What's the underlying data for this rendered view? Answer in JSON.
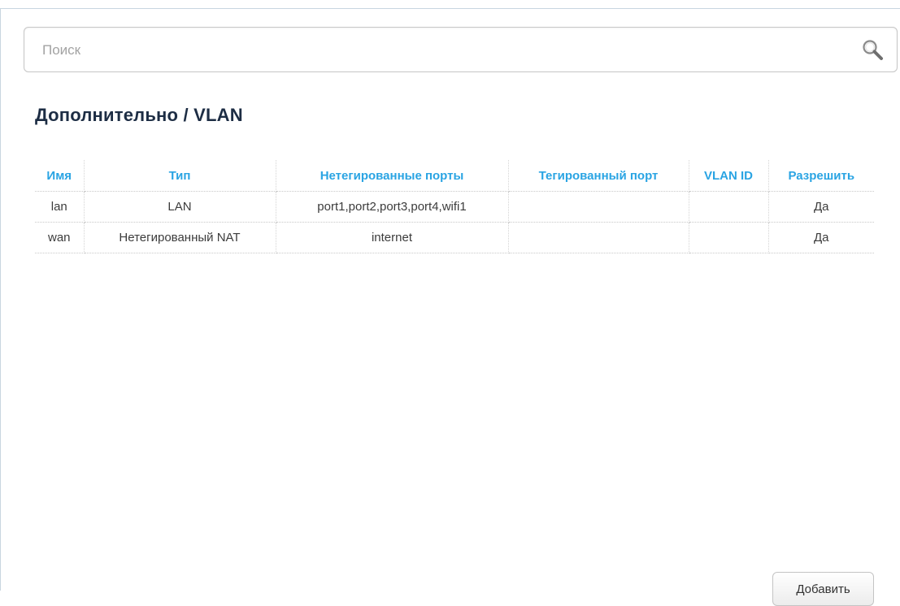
{
  "search": {
    "placeholder": "Поиск",
    "value": ""
  },
  "page": {
    "breadcrumb_parent": "Дополнительно",
    "breadcrumb_separator": " / ",
    "breadcrumb_current": "VLAN"
  },
  "table": {
    "headers": [
      "Имя",
      "Тип",
      "Нетегированные порты",
      "Тегированный порт",
      "VLAN ID",
      "Разрешить"
    ],
    "rows": [
      {
        "name": "lan",
        "type": "LAN",
        "untagged_ports": "port1,port2,port3,port4,wifi1",
        "tagged_port": "",
        "vlan_id": "",
        "enabled": "Да"
      },
      {
        "name": "wan",
        "type": "Нетегированный NAT",
        "untagged_ports": "internet",
        "tagged_port": "",
        "vlan_id": "",
        "enabled": "Да"
      }
    ]
  },
  "actions": {
    "add_label": "Добавить"
  },
  "colors": {
    "header_text": "#2aa4e3",
    "title_text": "#1d2d44",
    "cell_text": "#3c3c3c",
    "placeholder_text": "#a3a3a3"
  },
  "icons": {
    "search": "search-icon"
  }
}
